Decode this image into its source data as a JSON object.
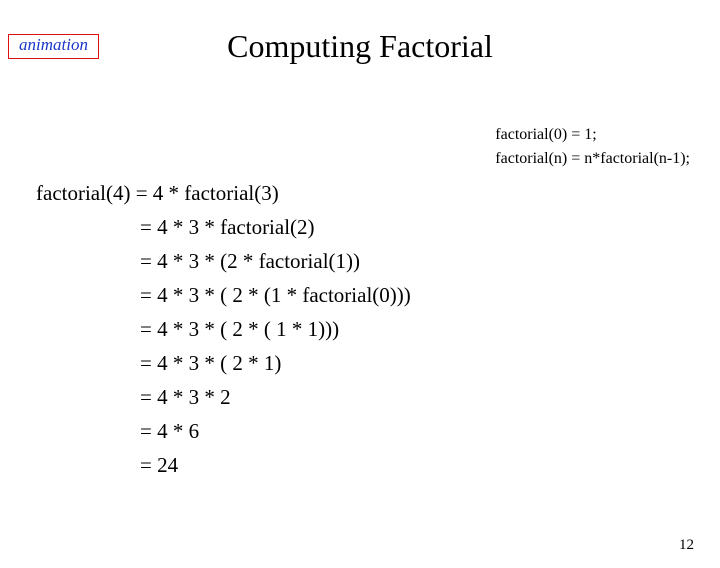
{
  "badge": "animation",
  "title": "Computing Factorial",
  "definitions": {
    "d0": "factorial(0) = 1;",
    "d1": "factorial(n) = n*factorial(n-1);"
  },
  "steps": {
    "s0": "factorial(4) = 4 * factorial(3)",
    "s1": "= 4 * 3 * factorial(2)",
    "s2": "= 4 * 3 * (2 * factorial(1))",
    "s3": "= 4 * 3 * ( 2 * (1 * factorial(0)))",
    "s4": "= 4 * 3 * ( 2 * ( 1 * 1)))",
    "s5": "= 4 * 3 * ( 2 * 1)",
    "s6": "= 4 * 3 * 2",
    "s7": "= 4 * 6",
    "s8": "= 24"
  },
  "page_number": "12"
}
